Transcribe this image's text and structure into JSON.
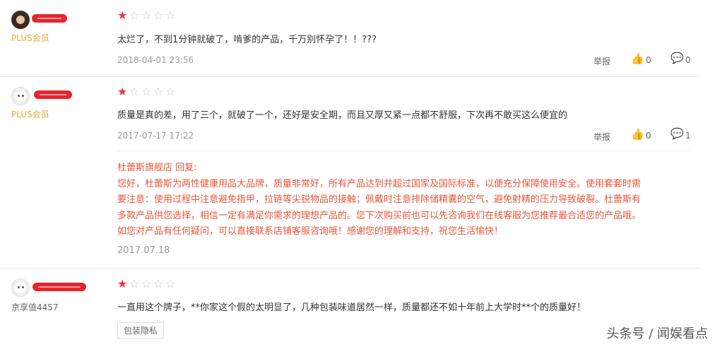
{
  "reviews": [
    {
      "level": "PLUS会员",
      "rating": 1,
      "text": "太烂了，不到1分钟就破了，啃爹的产品，千万别怀孕了！！???",
      "date": "2018-04-01 23:56",
      "report": "举报",
      "likes": "0",
      "comments": "0"
    },
    {
      "level": "PLUS会员",
      "rating": 1,
      "text": "质量是真的差，用了三个，就破了一个，还好是安全期，而且又厚又紧一点都不舒服，下次再不敢买这么便宜的",
      "date": "2017-07-17 17:22",
      "report": "举报",
      "likes": "0",
      "comments": "1",
      "reply": {
        "header": "杜蕾斯旗舰店 回复:",
        "lines": [
          "您好，杜蕾斯为两性健康用品大品牌，质量非常好，所有产品达到并超过国家及国际标准，以便充分保障使用安全。使用套套时需",
          "要注意：使用过程中注意避免指甲，拉链等尖锐物品的接触；佩戴时注意排除储精囊的空气，避免射精的压力导致破裂。杜蕾斯有",
          "多款产品供您选择，相信一定有满足你需求的理想产品的。您下次购买前也可以先咨询我们在线客服为您推荐最合适您的产品哦。",
          "如您对产品有任何疑问，可以直接联系店铺客服咨询哦！感谢您的理解和支持，祝您生活愉快！"
        ],
        "date": "2017.07.18"
      }
    },
    {
      "level": "京享值4457",
      "rating": 1,
      "text": "一直用这个牌子，**你家这个假的太明显了，几种包装味道居然一样，质量都还不如十年前上大学时**个的质量好！",
      "tag": "包装隐私"
    }
  ],
  "watermark": "头条号 / 闻娱看点",
  "colors": {
    "star": "#e4393c",
    "plus": "#e4a93a",
    "reply": "#e4563c",
    "redact": "#e8242c"
  },
  "icons": {
    "like": "thumbs-up-icon",
    "comment": "comment-bubble-icon",
    "star": "star-icon"
  }
}
